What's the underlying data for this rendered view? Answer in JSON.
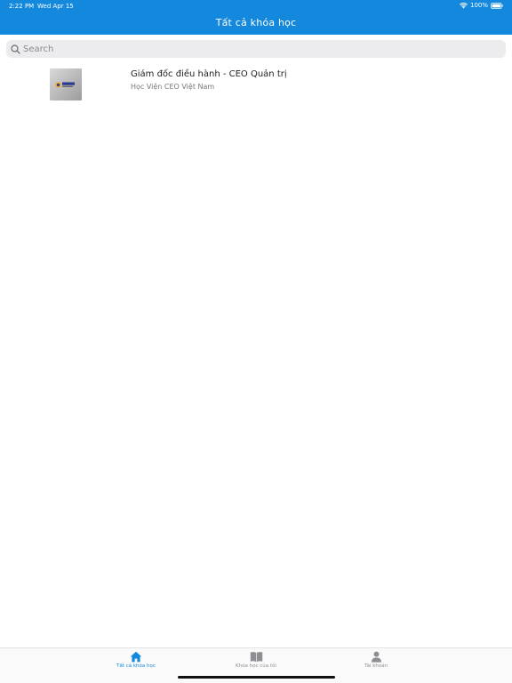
{
  "status_bar": {
    "time": "2:22 PM",
    "date": "Wed Apr 15",
    "battery": "100%",
    "icons": [
      "wifi-icon",
      "battery-icon"
    ]
  },
  "nav": {
    "title": "Tất cả khóa học"
  },
  "search": {
    "placeholder": "Search",
    "value": "",
    "icon": "search-icon"
  },
  "courses": [
    {
      "title": "Giám đốc điều hành - CEO Quản trị",
      "subtitle": "Học Viện CEO Việt Nam",
      "thumbnail": "ceo-logo-image"
    }
  ],
  "tabs": [
    {
      "label": "Tất cả khóa học",
      "icon": "home-icon",
      "active": true
    },
    {
      "label": "Khóa học của tôi",
      "icon": "book-icon",
      "active": false
    },
    {
      "label": "Tài khoản",
      "icon": "user-icon",
      "active": false
    }
  ],
  "colors": {
    "accent": "#1488dc",
    "tab_inactive": "#8e8e93",
    "search_bg": "#ececee"
  }
}
